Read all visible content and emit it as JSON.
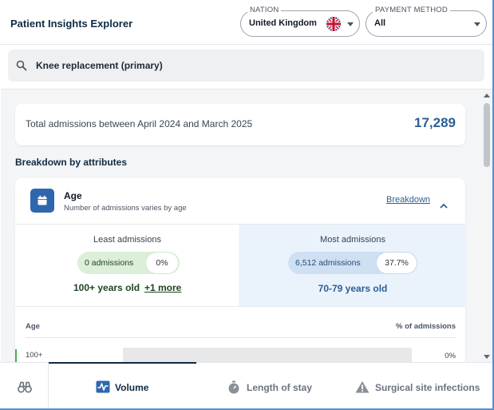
{
  "header": {
    "title": "Patient Insights Explorer",
    "nation": {
      "legend": "NATION",
      "value": "United Kingdom",
      "flag_icon": "uk-flag-icon"
    },
    "payment": {
      "legend": "PAYMENT METHOD",
      "value": "All"
    }
  },
  "search": {
    "value": "Knee replacement (primary)",
    "icon": "search-icon"
  },
  "summary": {
    "label": "Total admissions between April 2024 and March 2025",
    "value": "17,289"
  },
  "breakdown": {
    "section_title": "Breakdown by attributes",
    "age": {
      "title": "Age",
      "subtitle": "Number of admissions varies by age",
      "toggle_label": "Breakdown",
      "least": {
        "heading": "Least admissions",
        "admissions": "0 admissions",
        "percent": "0%",
        "group": "100+ years old",
        "more": "+1 more"
      },
      "most": {
        "heading": "Most admissions",
        "admissions": "6,512 admissions",
        "percent": "37.7%",
        "group": "70-79 years old"
      },
      "table": {
        "col_age": "Age",
        "col_pct": "% of admissions",
        "rows": [
          {
            "label": "100+",
            "percent": "0%",
            "share": 0
          }
        ]
      }
    }
  },
  "tabs": [
    {
      "label": "Volume",
      "icon": "volume-chart-icon",
      "active": true
    },
    {
      "label": "Length of stay",
      "icon": "stopwatch-icon",
      "active": false
    },
    {
      "label": "Surgical site infections",
      "icon": "warning-icon",
      "active": false
    }
  ],
  "colors": {
    "accent": "#2c5f93",
    "icon_box": "#2f67ad",
    "least_pill": "#dcefd9",
    "most_pill": "#cfe0f3",
    "most_panel": "#eaf3fc"
  }
}
